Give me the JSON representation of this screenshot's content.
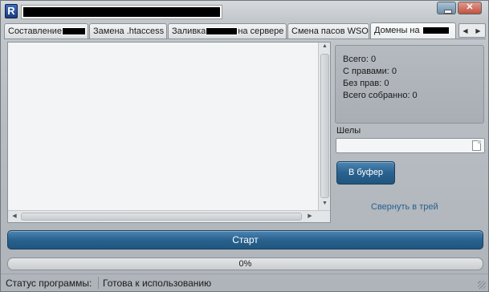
{
  "titlebar": {
    "logo_letter": "R"
  },
  "tabs": [
    {
      "label": "Составление",
      "redacted": true
    },
    {
      "label": "Замена .htaccess"
    },
    {
      "label_before": "Заливка",
      "label_after": "на сервере",
      "redacted": true
    },
    {
      "label": "Смена пасов  WSO"
    },
    {
      "label": "Домены на",
      "redacted": true,
      "active": true
    }
  ],
  "stats": {
    "total": "Всего: 0",
    "with_rights": "С правами: 0",
    "no_rights": "Без прав: 0",
    "collected": "Всего собранно: 0"
  },
  "shells": {
    "label": "Шелы",
    "value": ""
  },
  "buttons": {
    "buffer": "В буфер",
    "tray": "Свернуть в трей",
    "start": "Старт"
  },
  "progress": {
    "text": "0%",
    "value": 0
  },
  "statusbar": {
    "label": "Статус программы:",
    "value": "Готова к использованию"
  },
  "colors": {
    "accent": "#2a628f",
    "link": "#2a5f8f"
  }
}
